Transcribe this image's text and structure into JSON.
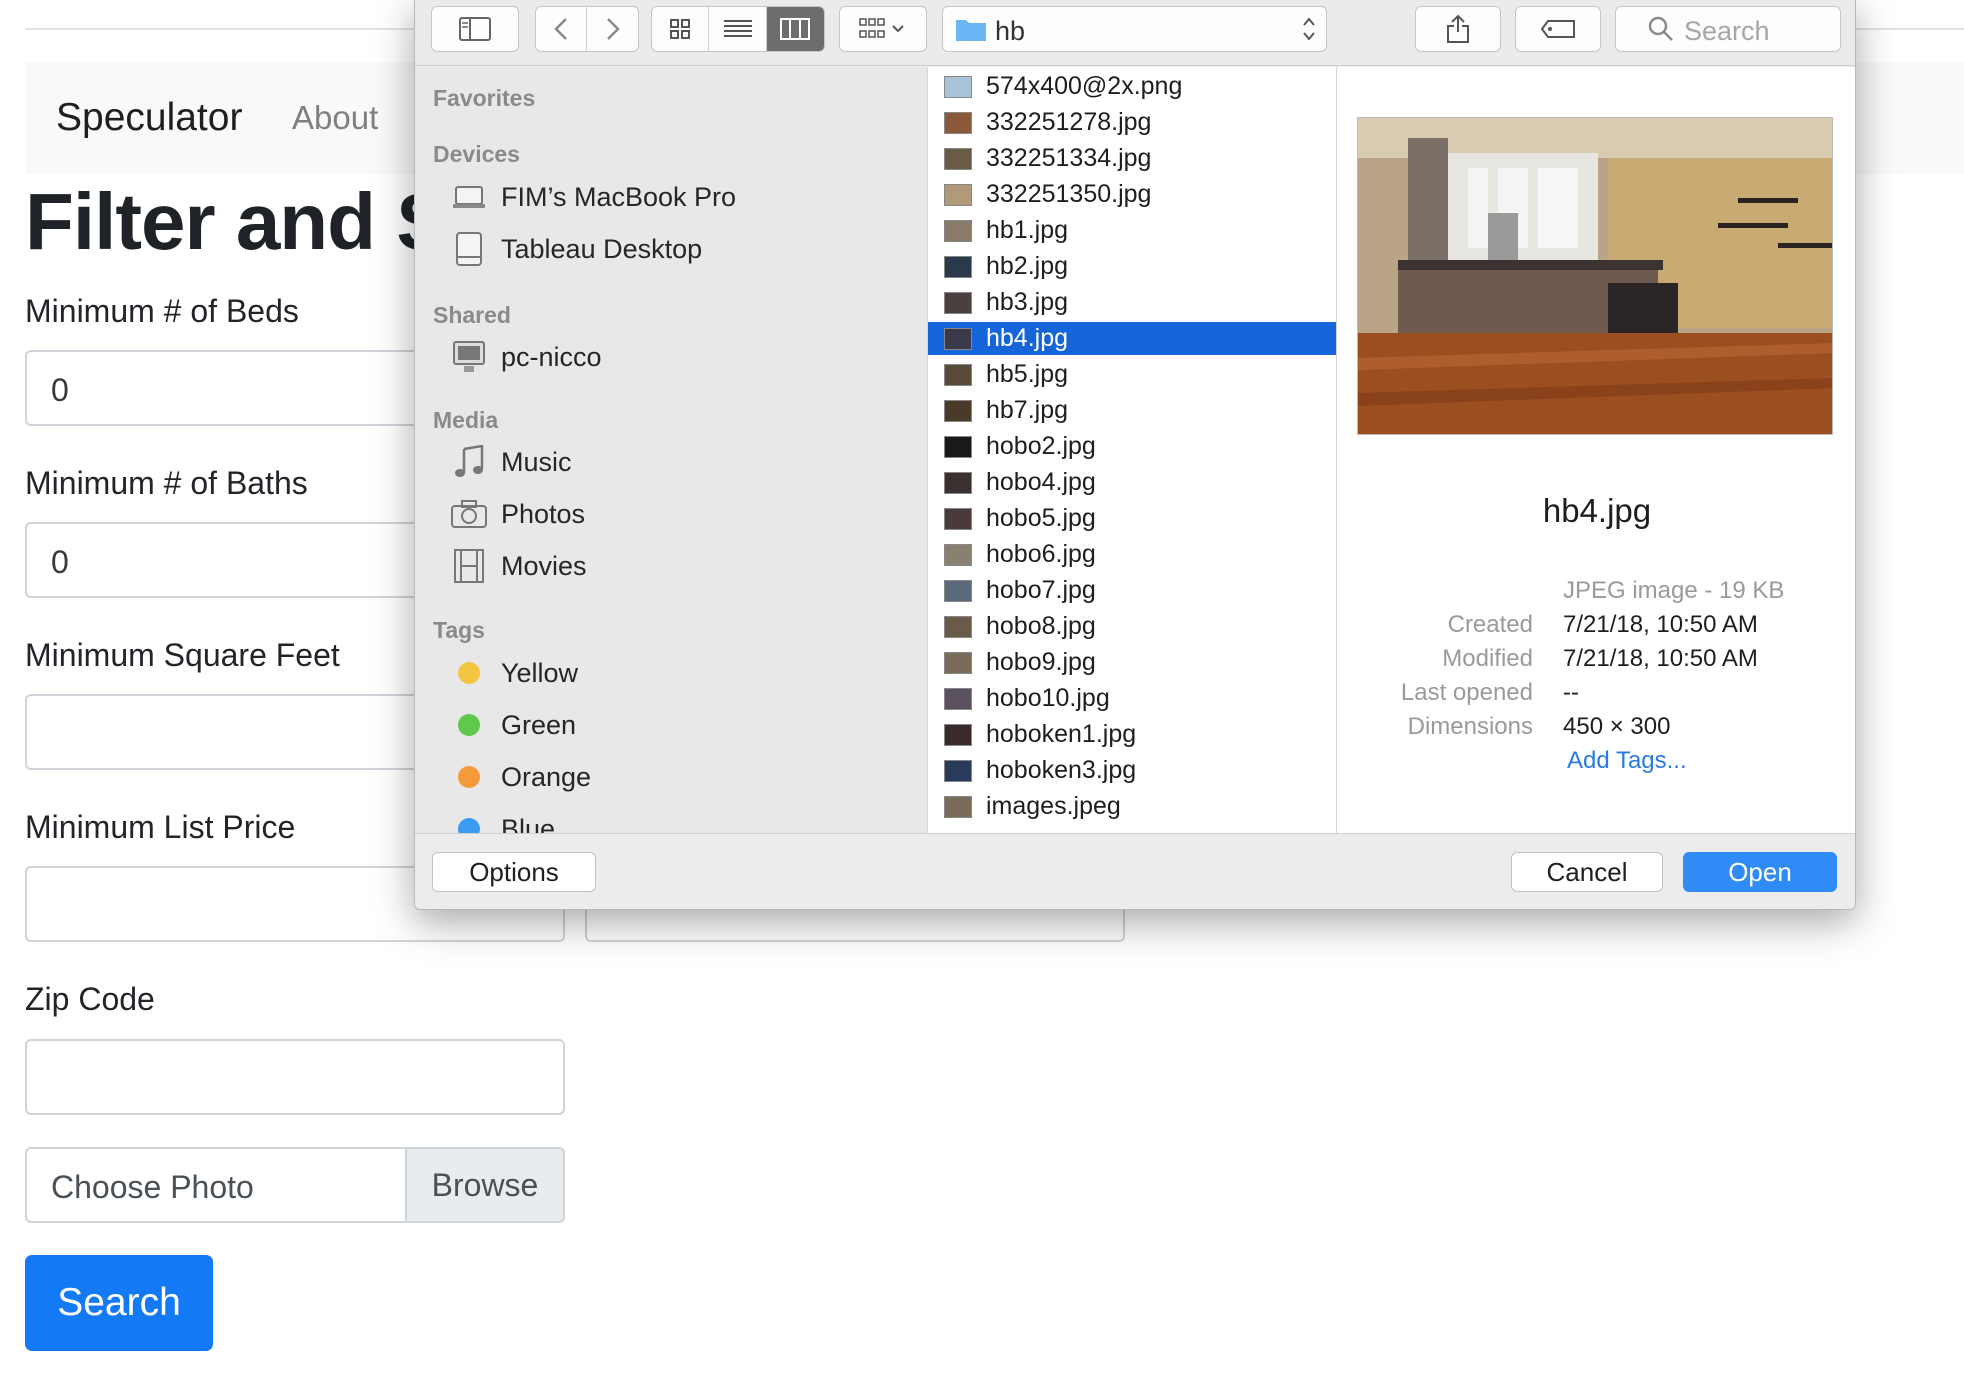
{
  "page": {
    "brand": "Speculator",
    "nav": [
      "About"
    ],
    "title": "Filter and Se",
    "fields": {
      "beds_label": "Minimum # of Beds",
      "beds_value": "0",
      "baths_label": "Minimum # of Baths",
      "baths_value": "0",
      "sqft_label": "Minimum Square Feet",
      "price_label": "Minimum List Price",
      "zip_label": "Zip Code"
    },
    "file_input": {
      "label": "Choose Photo",
      "browse": "Browse"
    },
    "search_button": "Search"
  },
  "dialog": {
    "path": "hb",
    "search_placeholder": "Search",
    "sidebar": {
      "favorites": "Favorites",
      "devices": "Devices",
      "devices_items": [
        "FIM’s MacBook Pro",
        "Tableau Desktop"
      ],
      "shared": "Shared",
      "shared_items": [
        "pc-nicco"
      ],
      "media": "Media",
      "media_items": [
        "Music",
        "Photos",
        "Movies"
      ],
      "tags": "Tags",
      "tag_items": [
        {
          "label": "Yellow",
          "color": "#f5c542"
        },
        {
          "label": "Green",
          "color": "#5ec94a"
        },
        {
          "label": "Orange",
          "color": "#f59a3b"
        },
        {
          "label": "Blue",
          "color": "#3b9bf0"
        }
      ]
    },
    "files": [
      "574x400@2x.png",
      "332251278.jpg",
      "332251334.jpg",
      "332251350.jpg",
      "hb1.jpg",
      "hb2.jpg",
      "hb3.jpg",
      "hb4.jpg",
      "hb5.jpg",
      "hb7.jpg",
      "hobo2.jpg",
      "hobo4.jpg",
      "hobo5.jpg",
      "hobo6.jpg",
      "hobo7.jpg",
      "hobo8.jpg",
      "hobo9.jpg",
      "hobo10.jpg",
      "hoboken1.jpg",
      "hoboken3.jpg",
      "images.jpeg"
    ],
    "selected_file": "hb4.jpg",
    "preview": {
      "name": "hb4.jpg",
      "kind": "JPEG image - 19 KB",
      "created_label": "Created",
      "created": "7/21/18, 10:50 AM",
      "modified_label": "Modified",
      "modified": "7/21/18, 10:50 AM",
      "last_opened_label": "Last opened",
      "last_opened": "--",
      "dimensions_label": "Dimensions",
      "dimensions": "450 × 300",
      "add_tags": "Add Tags..."
    },
    "options_button": "Options",
    "cancel_button": "Cancel",
    "open_button": "Open"
  }
}
